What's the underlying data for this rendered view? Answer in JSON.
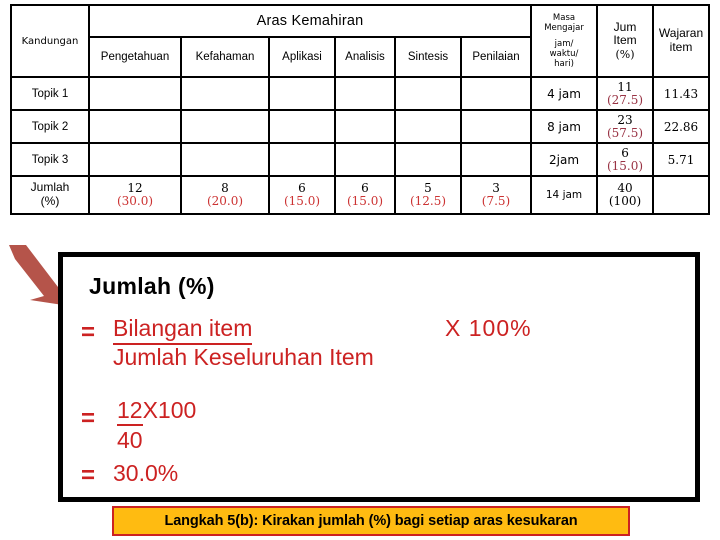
{
  "table": {
    "header": {
      "kandungan": "Kandungan",
      "aras_kemahiran": "Aras Kemahiran",
      "masa_mengajar_line1": "Masa",
      "masa_mengajar_line2": "Mengajar",
      "masa_unit_line1": "jam/",
      "masa_unit_line2": "waktu/",
      "masa_unit_line3": "hari)",
      "jum_item_line1": "Jum",
      "jum_item_line2": "Item",
      "jum_item_line3": "(%)",
      "wajaran_line1": "Wajaran",
      "wajaran_line2": "item",
      "skills": [
        "Pengetahuan",
        "Kefahaman",
        "Aplikasi",
        "Analisis",
        "Sintesis",
        "Penilaian"
      ]
    },
    "rows": [
      {
        "topic": "Topik 1",
        "skills": [
          "",
          "",
          "",
          "",
          "",
          ""
        ],
        "masa": "4 jam",
        "jum_item": "11",
        "jum_item_pct": "(27.5)",
        "wajaran": "11.43"
      },
      {
        "topic": "Topik 2",
        "skills": [
          "",
          "",
          "",
          "",
          "",
          ""
        ],
        "masa": "8 jam",
        "jum_item": "23",
        "jum_item_pct": "(57.5)",
        "wajaran": "22.86"
      },
      {
        "topic": "Topik 3",
        "skills": [
          "",
          "",
          "",
          "",
          "",
          ""
        ],
        "masa": "2jam",
        "jum_item": "6",
        "jum_item_pct": "(15.0)",
        "wajaran": "5.71"
      }
    ],
    "total_row": {
      "label_line1": "Jumlah",
      "label_line2": "(%)",
      "skills": [
        {
          "count": "12",
          "pct": "(30.0)"
        },
        {
          "count": "8",
          "pct": "(20.0)"
        },
        {
          "count": "6",
          "pct": "(15.0)"
        },
        {
          "count": "6",
          "pct": "(15.0)"
        },
        {
          "count": "5",
          "pct": "(12.5)"
        },
        {
          "count": "3",
          "pct": "(7.5)"
        }
      ],
      "masa": "14 jam",
      "jum_item": "40",
      "jum_item_pct": "(100)",
      "wajaran": ""
    }
  },
  "formula": {
    "title": "Jumlah (%)",
    "equals": "=",
    "line1_numerator": "Bilangan item",
    "line1_denominator": "Jumlah Keseluruhan Item",
    "line1_tail": "X  100%",
    "line2_numerator": "12",
    "line2_multiplier": "X100",
    "line2_denominator": "40",
    "result": "30.0%"
  },
  "caption": {
    "text": "Langkah 5(b): Kirakan jumlah (%) bagi setiap aras kesukaran"
  },
  "colors": {
    "table_border": "#000000",
    "percent_red": "#CC3333",
    "percent_maroon": "#993344",
    "formula_red": "#CC2222",
    "arrow_red": "#B5544A",
    "caption_bg": "#FFBB11",
    "caption_border": "#CC2222"
  }
}
